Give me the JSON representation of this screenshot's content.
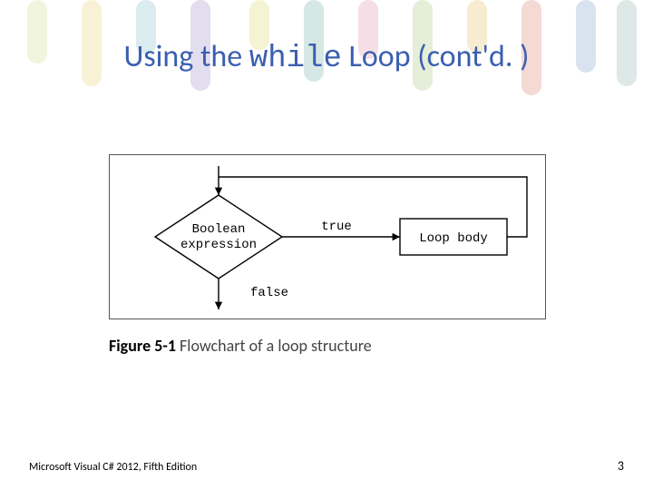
{
  "title": {
    "prefix": "Using the ",
    "mono": "while",
    "suffix": " Loop (cont'd. )"
  },
  "diagram": {
    "decision_line1": "Boolean",
    "decision_line2": "expression",
    "true_label": "true",
    "false_label": "false",
    "loop_body": "Loop body"
  },
  "caption": {
    "fig_num": "Figure 5-1",
    "text": " Flowchart of a loop structure"
  },
  "footer": {
    "left": "Microsoft Visual C# 2012, Fifth Edition",
    "page": "3"
  },
  "chart_data": {
    "type": "flowchart",
    "title": "Flowchart of a loop structure",
    "nodes": [
      {
        "id": "decision",
        "kind": "decision",
        "label": "Boolean expression"
      },
      {
        "id": "body",
        "kind": "process",
        "label": "Loop body"
      }
    ],
    "edges": [
      {
        "from": "entry",
        "to": "decision"
      },
      {
        "from": "decision",
        "to": "body",
        "label": "true"
      },
      {
        "from": "body",
        "to": "decision",
        "kind": "loopback"
      },
      {
        "from": "decision",
        "to": "exit",
        "label": "false"
      }
    ]
  }
}
